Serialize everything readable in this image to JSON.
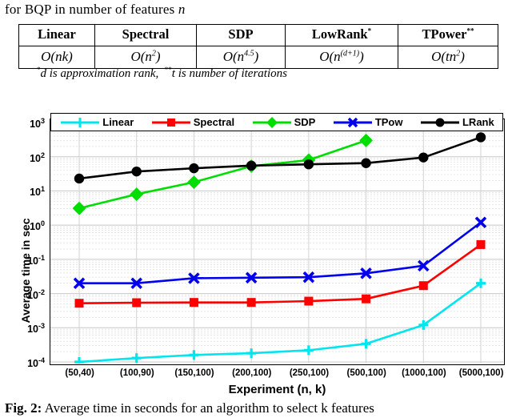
{
  "intro_text_pre": "for BQP in number of features ",
  "intro_text_var": "n",
  "table": {
    "headers": [
      "Linear",
      "Spectral",
      "SDP",
      "LowRank",
      "TPower"
    ],
    "header_marks": [
      "",
      "",
      "",
      "*",
      "**"
    ],
    "complexities": [
      "O(nk)",
      "O(n2)",
      "O(n4.5)",
      "O(n(d+1))",
      "O(tn2)"
    ],
    "cells": [
      {
        "base": "O(n",
        "sup": "",
        "tail": "k)"
      },
      {
        "base": "O(n",
        "sup": "2",
        "tail": ")"
      },
      {
        "base": "O(n",
        "sup": "4.5",
        "tail": ")"
      },
      {
        "base": "O(n",
        "sup": "(d+1)",
        "tail": ")"
      },
      {
        "base": "O(tn",
        "sup": "2",
        "tail": ")"
      }
    ],
    "footnote_1": "d is approximation rank,",
    "footnote_1_mark": "*",
    "footnote_2": "t is number of iterations",
    "footnote_2_mark": "**"
  },
  "chart_data": {
    "type": "line",
    "title": "",
    "xlabel": "Experiment (n, k)",
    "ylabel": "Average time in sec",
    "yscale": "log",
    "ylim": [
      0.0001,
      1000
    ],
    "ytick_labels": [
      "10-4",
      "10-3",
      "10-2",
      "10-1",
      "100",
      "101",
      "102",
      "103"
    ],
    "ytick_mantissas": [
      "10",
      "10",
      "10",
      "10",
      "10",
      "10",
      "10",
      "10"
    ],
    "ytick_exponents": [
      "-4",
      "-3",
      "-2",
      "-1",
      "0",
      "1",
      "2",
      "3"
    ],
    "grid": true,
    "legend_position": "top",
    "categories": [
      "(50,40)",
      "(100,90)",
      "(150,100)",
      "(200,100)",
      "(250,100)",
      "(500,100)",
      "(1000,100)",
      "(5000,100)"
    ],
    "series": [
      {
        "name": "Linear",
        "color": "#00e5ee",
        "marker": "plus",
        "values": [
          0.0001,
          0.00013,
          0.00016,
          0.00018,
          0.00022,
          0.00034,
          0.0012,
          0.02
        ]
      },
      {
        "name": "Spectral",
        "color": "#ff0000",
        "marker": "square",
        "values": [
          0.0052,
          0.0054,
          0.0055,
          0.0055,
          0.006,
          0.007,
          0.017,
          0.27
        ]
      },
      {
        "name": "SDP",
        "color": "#00dd00",
        "marker": "diamond",
        "values": [
          3.1,
          8.0,
          18.0,
          53.0,
          80.0,
          300.0,
          null,
          null
        ]
      },
      {
        "name": "TPow",
        "color": "#0000ee",
        "marker": "cross",
        "values": [
          0.02,
          0.02,
          0.028,
          0.029,
          0.03,
          0.039,
          0.065,
          1.2
        ]
      },
      {
        "name": "LRank",
        "color": "#000000",
        "marker": "circle",
        "values": [
          23.0,
          37.0,
          46.0,
          55.0,
          60.0,
          65.0,
          95.0,
          370.0
        ]
      }
    ]
  },
  "legend": {
    "items": [
      {
        "label": "Linear",
        "color": "#00e5ee",
        "marker": "plus"
      },
      {
        "label": "Spectral",
        "color": "#ff0000",
        "marker": "square"
      },
      {
        "label": "SDP",
        "color": "#00dd00",
        "marker": "diamond"
      },
      {
        "label": "TPow",
        "color": "#0000ee",
        "marker": "cross"
      },
      {
        "label": "LRank",
        "color": "#000000",
        "marker": "circle"
      }
    ]
  },
  "figure_caption_label": "Fig. 2:",
  "figure_caption_text": "Average time in seconds for an algorithm to select k features"
}
